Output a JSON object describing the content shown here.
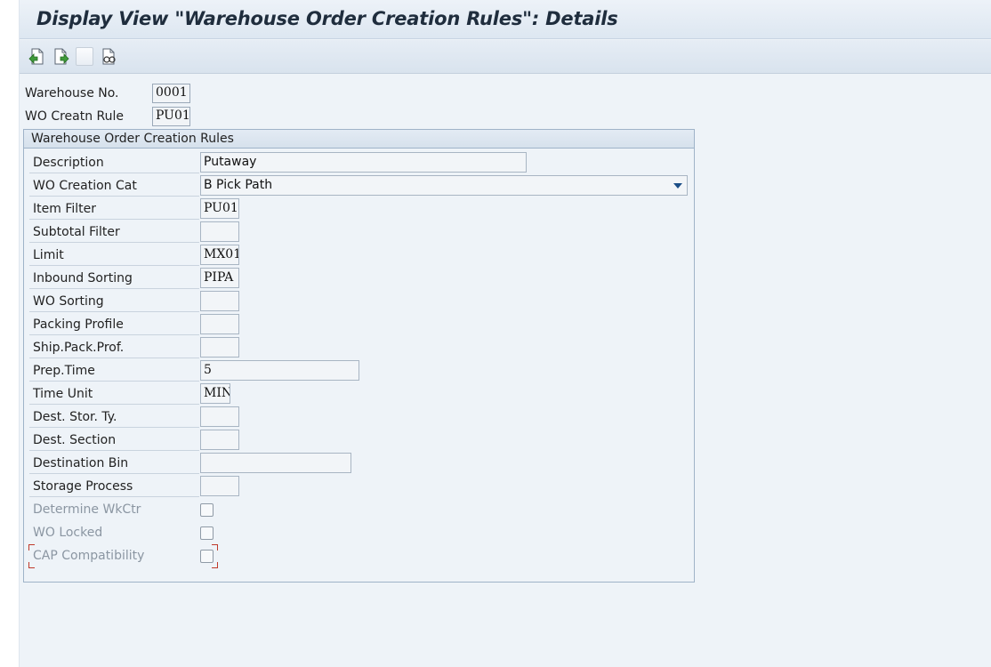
{
  "title": "Display View \"Warehouse Order Creation Rules\": Details",
  "toolbar": {
    "icons": [
      "previous-entry-icon",
      "next-entry-icon",
      "blank-button",
      "where-used-icon"
    ]
  },
  "header": {
    "warehouse_label": "Warehouse No.",
    "warehouse_value": "0001",
    "rule_label": "WO Creatn Rule",
    "rule_value": "PU01"
  },
  "group": {
    "title": "Warehouse Order Creation Rules",
    "fields": [
      {
        "label": "Description",
        "value": "Putaway"
      },
      {
        "label": "WO Creation Cat",
        "value": "B Pick Path"
      },
      {
        "label": "Item Filter",
        "value": "PU01"
      },
      {
        "label": "Subtotal Filter",
        "value": ""
      },
      {
        "label": "Limit",
        "value": "MX01"
      },
      {
        "label": "Inbound Sorting",
        "value": "PIPA"
      },
      {
        "label": "WO Sorting",
        "value": ""
      },
      {
        "label": "Packing Profile",
        "value": ""
      },
      {
        "label": "Ship.Pack.Prof.",
        "value": ""
      },
      {
        "label": "Prep.Time",
        "value": "5"
      },
      {
        "label": "Time Unit",
        "value": "MIN"
      },
      {
        "label": "Dest. Stor. Ty.",
        "value": ""
      },
      {
        "label": "Dest. Section",
        "value": ""
      },
      {
        "label": "Destination Bin",
        "value": ""
      },
      {
        "label": "Storage Process",
        "value": ""
      }
    ],
    "checkboxes": [
      {
        "label": "Determine WkCtr",
        "checked": false
      },
      {
        "label": "WO Locked",
        "checked": false
      },
      {
        "label": "CAP Compatibility",
        "checked": false
      }
    ]
  }
}
